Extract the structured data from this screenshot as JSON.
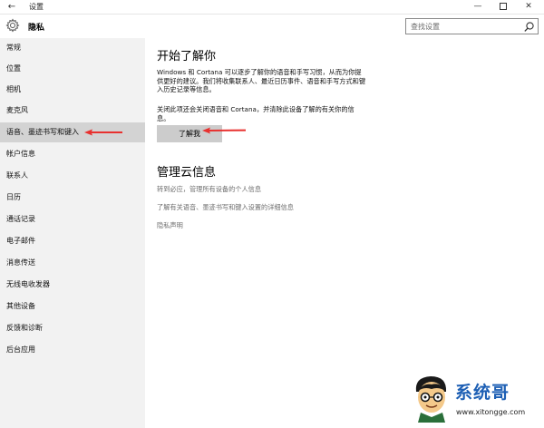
{
  "window": {
    "title": "设置",
    "back_glyph": "←",
    "minimize_glyph": "—",
    "close_glyph": "✕"
  },
  "header": {
    "title": "隐私",
    "search_placeholder": "查找设置"
  },
  "sidebar": {
    "items": [
      {
        "label": "常规"
      },
      {
        "label": "位置"
      },
      {
        "label": "相机"
      },
      {
        "label": "麦克风"
      },
      {
        "label": "语音、墨迹书写和键入",
        "selected": true
      },
      {
        "label": "帐户信息"
      },
      {
        "label": "联系人"
      },
      {
        "label": "日历"
      },
      {
        "label": "通话记录"
      },
      {
        "label": "电子邮件"
      },
      {
        "label": "消息传送"
      },
      {
        "label": "无线电收发器"
      },
      {
        "label": "其他设备"
      },
      {
        "label": "反馈和诊断"
      },
      {
        "label": "后台应用"
      }
    ]
  },
  "main": {
    "section1_title": "开始了解你",
    "section1_desc": "Windows 和 Cortana 可以逐步了解你的语音和手写习惯，从而为你提供更好的建议。我们将收集联系人、最近日历事件、语音和手写方式和键入历史记录等信息。",
    "section1_note": "关闭此项还会关闭语音和 Cortana，并清除此设备了解的有关你的信息。",
    "learn_button": "了解我",
    "section2_title": "管理云信息",
    "link1": "转到必应，管理所有设备的个人信息",
    "link2": "了解有关语音、墨迹书写和键入设置的详细信息",
    "link3": "隐私声明"
  },
  "watermark": {
    "title": "系统哥",
    "url": "www.xitongge.com"
  },
  "colors": {
    "sidebar_bg": "#f2f2f2",
    "selected_bg": "#d3d3d3",
    "button_bg": "#cccccc",
    "arrow_red": "#e8312f",
    "link_gray": "#6e6e6e",
    "brand_blue": "#1d5fb4"
  }
}
